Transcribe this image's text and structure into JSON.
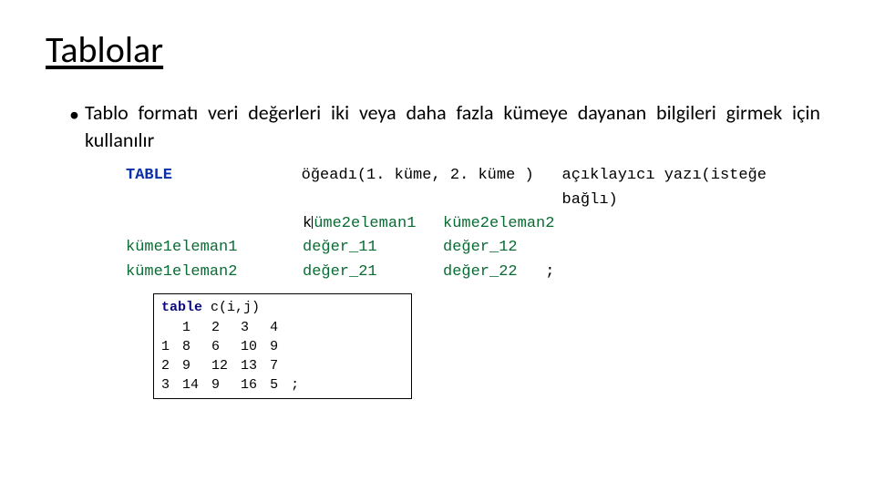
{
  "slide": {
    "title": "Tablolar",
    "bullet": "Tablo formatı veri değerleri iki veya daha fazla kümeye dayanan bilgileri girmek için kullanılır"
  },
  "syntax": {
    "keyword": "TABLE",
    "item_name": "öğeadı(1. küme, 2. küme )",
    "description": "açıklayıcı yazı(isteğe bağlı)",
    "col_head_prefix": "k",
    "col_head_1": "üme2eleman1",
    "col_head_2": "küme2eleman2",
    "row_label_1": "küme1eleman1",
    "row_label_2": "küme1eleman2",
    "val_11": "değer_11",
    "val_12": "değer_12",
    "val_21": "değer_21",
    "val_22": "değer_22",
    "semicolon": ";"
  },
  "example": {
    "kw": "table",
    "call": " c(i,j)",
    "headers": [
      "",
      "1",
      "2",
      "3",
      "4"
    ],
    "rows": [
      [
        "1",
        "8",
        "6",
        "10",
        "9"
      ],
      [
        "2",
        "9",
        "12",
        "13",
        "7"
      ],
      [
        "3",
        "14",
        "9",
        "16",
        "5"
      ]
    ],
    "semicolon": ";"
  }
}
